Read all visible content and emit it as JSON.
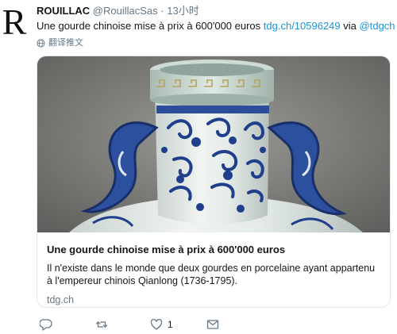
{
  "tweet": {
    "author_name": "ROUILLAC",
    "author_handle": "@RouillacSas",
    "separator": "·",
    "time": "13小时",
    "text": "Une gourde chinoise mise à prix à 600'000 euros",
    "link": "tdg.ch/10596249",
    "via_text": "via",
    "via_handle": "@tdgch",
    "translate_label": "翻译推文",
    "avatar_letter": "R"
  },
  "card": {
    "title": "Une gourde chinoise mise à prix à 600'000 euros",
    "description": "Il n'existe dans le monde que deux gourdes en porcelaine ayant appartenu à l'empereur chinois Qianlong (1736-1795).",
    "domain": "tdg.ch"
  },
  "actions": {
    "reply_icon": "reply-icon",
    "retweet_icon": "retweet-icon",
    "like_icon": "heart-icon",
    "like_count": "1",
    "message_icon": "message-icon"
  },
  "colors": {
    "link": "#1b95e0",
    "secondary": "#657786",
    "porcelain_blue": "#1f3e8c"
  }
}
